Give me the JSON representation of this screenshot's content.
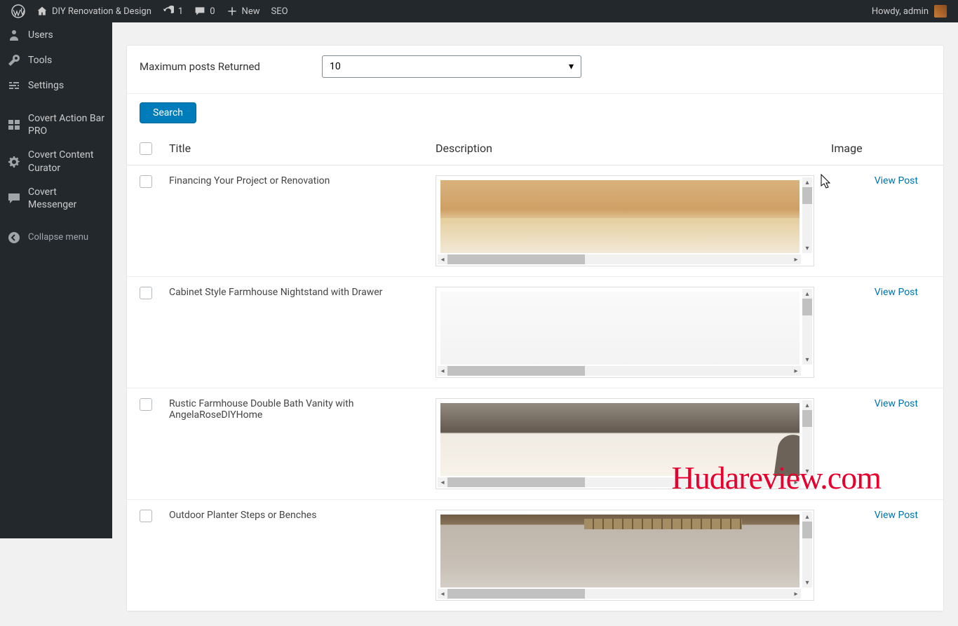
{
  "adminBar": {
    "siteName": "DIY Renovation & Design",
    "updateCount": "1",
    "commentCount": "0",
    "newLabel": "New",
    "seoLabel": "SEO",
    "howdy": "Howdy, admin"
  },
  "sidebar": {
    "items": [
      {
        "label": "Users",
        "icon": "users"
      },
      {
        "label": "Tools",
        "icon": "wrench"
      },
      {
        "label": "Settings",
        "icon": "sliders"
      }
    ],
    "pluginItems": [
      {
        "label": "Covert Action Bar PRO",
        "icon": "grid"
      },
      {
        "label": "Covert Content Curator",
        "icon": "gear"
      },
      {
        "label": "Covert Messenger",
        "icon": "chat"
      }
    ],
    "collapseLabel": "Collapse menu"
  },
  "form": {
    "maxPostsLabel": "Maximum posts Returned",
    "maxPostsValue": "10",
    "searchLabel": "Search"
  },
  "table": {
    "headers": {
      "title": "Title",
      "description": "Description",
      "image": "Image"
    },
    "viewPostLabel": "View Post",
    "rows": [
      {
        "title": "Financing Your Project or Renovation",
        "imgClass": "wood-light"
      },
      {
        "title": "Cabinet Style Farmhouse Nightstand with Drawer",
        "imgClass": "plain-white"
      },
      {
        "title": "Rustic Farmhouse Double Bath Vanity with AngelaRoseDIYHome",
        "imgClass": "gray-wood"
      },
      {
        "title": "Outdoor Planter Steps or Benches",
        "imgClass": "outdoor"
      }
    ]
  },
  "watermark": "Hudareview.com"
}
